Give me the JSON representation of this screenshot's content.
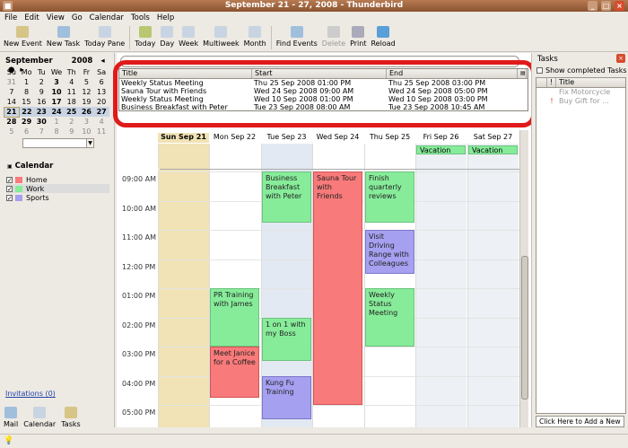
{
  "window": {
    "title": "September 21 - 27, 2008 - Thunderbird"
  },
  "menu": [
    "File",
    "Edit",
    "View",
    "Go",
    "Calendar",
    "Tools",
    "Help"
  ],
  "toolbar": {
    "buttons": [
      {
        "label": "New Event",
        "icon": "new-event-icon",
        "color": "#d7c487"
      },
      {
        "label": "New Task",
        "icon": "new-task-icon",
        "color": "#9fbfdd"
      },
      {
        "label": "Today Pane",
        "icon": "today-pane-icon",
        "color": "#c9d4e3",
        "badge": "31"
      },
      {
        "label": "Today",
        "icon": "today-icon",
        "color": "#b9c870"
      },
      {
        "label": "Day",
        "icon": "day-icon",
        "color": "#c9d4e3"
      },
      {
        "label": "Week",
        "icon": "week-icon",
        "color": "#c9d4e3"
      },
      {
        "label": "Multiweek",
        "icon": "multiweek-icon",
        "color": "#c9d4e3"
      },
      {
        "label": "Month",
        "icon": "month-icon",
        "color": "#c9d4e3"
      },
      {
        "label": "Find Events",
        "icon": "find-events-icon",
        "color": "#9fbfdd"
      },
      {
        "label": "Delete",
        "icon": "delete-icon",
        "color": "#cccccc",
        "disabled": true
      },
      {
        "label": "Print",
        "icon": "print-icon",
        "color": "#aab"
      },
      {
        "label": "Reload",
        "icon": "reload-icon",
        "color": "#5aa0d8"
      }
    ]
  },
  "mini_calendar": {
    "month": "September",
    "year": "2008",
    "weekdays": [
      "Su",
      "Mo",
      "Tu",
      "We",
      "Th",
      "Fr",
      "Sa"
    ],
    "rows": [
      [
        "31",
        "1",
        "2",
        "3",
        "4",
        "5",
        "6"
      ],
      [
        "7",
        "8",
        "9",
        "10",
        "11",
        "12",
        "13"
      ],
      [
        "14",
        "15",
        "16",
        "17",
        "18",
        "19",
        "20"
      ],
      [
        "21",
        "22",
        "23",
        "24",
        "25",
        "26",
        "27"
      ],
      [
        "28",
        "29",
        "30",
        "1",
        "2",
        "3",
        "4"
      ],
      [
        "5",
        "6",
        "7",
        "8",
        "9",
        "10",
        "11"
      ]
    ]
  },
  "calendars": {
    "title": "Calendar",
    "items": [
      {
        "name": "Home",
        "color": "#f87a7a"
      },
      {
        "name": "Work",
        "color": "#87ec9a"
      },
      {
        "name": "Sports",
        "color": "#a5a0f0"
      }
    ]
  },
  "invitations": "Invitations (0)",
  "bottom_tabs": [
    {
      "label": "Mail",
      "icon": "mail-icon"
    },
    {
      "label": "Calendar",
      "icon": "calendar-icon"
    },
    {
      "label": "Tasks",
      "icon": "tasks-icon"
    }
  ],
  "event_list": {
    "headers": [
      "Title",
      "Start",
      "End"
    ],
    "rows": [
      [
        "Weekly Status Meeting",
        "Thu 25 Sep 2008 01:00 PM",
        "Thu 25 Sep 2008 03:00 PM"
      ],
      [
        "Sauna Tour with Friends",
        "Wed 24 Sep 2008 09:00 AM",
        "Wed 24 Sep 2008 05:00 PM"
      ],
      [
        "Weekly Status Meeting",
        "Wed 10 Sep 2008 01:00 PM",
        "Wed 10 Sep 2008 03:00 PM"
      ],
      [
        "Business Breakfast with Peter",
        "Tue 23 Sep 2008 08:00 AM",
        "Tue 23 Sep 2008 10:45 AM"
      ]
    ]
  },
  "week_view": {
    "days": [
      "Sun Sep 21",
      "Mon Sep 22",
      "Tue Sep 23",
      "Wed Sep 24",
      "Thu Sep 25",
      "Fri Sep 26",
      "Sat Sep 27"
    ],
    "hours": [
      "09:00 AM",
      "10:00 AM",
      "11:00 AM",
      "12:00 PM",
      "01:00 PM",
      "02:00 PM",
      "03:00 PM",
      "04:00 PM",
      "05:00 PM"
    ],
    "allday": [
      {
        "day": 5,
        "title": "Vacation"
      },
      {
        "day": 6,
        "title": "Vacation"
      }
    ],
    "events": [
      {
        "title": "Business Breakfast with Peter",
        "day": 2,
        "start": 9.0,
        "end": 10.75,
        "color": "green"
      },
      {
        "title": "Sauna Tour with Friends",
        "day": 3,
        "start": 9.0,
        "end": 17.0,
        "color": "red"
      },
      {
        "title": "Finish quarterly reviews",
        "day": 4,
        "start": 9.0,
        "end": 10.75,
        "color": "green"
      },
      {
        "title": "Visit Driving Range with Colleagues",
        "day": 4,
        "start": 11.0,
        "end": 12.5,
        "color": "blue"
      },
      {
        "title": "PR Training with James",
        "day": 1,
        "start": 13.0,
        "end": 15.0,
        "color": "green"
      },
      {
        "title": "Weekly Status Meeting",
        "day": 4,
        "start": 13.0,
        "end": 15.0,
        "color": "green"
      },
      {
        "title": "1 on 1 with my Boss",
        "day": 2,
        "start": 14.0,
        "end": 15.5,
        "color": "green"
      },
      {
        "title": "Meet Janice for a Coffee",
        "day": 1,
        "start": 15.0,
        "end": 16.75,
        "color": "red"
      },
      {
        "title": "Kung Fu Training",
        "day": 2,
        "start": 16.0,
        "end": 17.5,
        "color": "blue"
      }
    ]
  },
  "tasks": {
    "title": "Tasks",
    "show_completed": "Show completed Tasks",
    "column_title": "Title",
    "items": [
      {
        "title": "Fix Motorcycle",
        "priority": ""
      },
      {
        "title": "Buy Gift for ...",
        "priority": "!"
      }
    ],
    "add_placeholder": "Click Here to Add a New"
  }
}
